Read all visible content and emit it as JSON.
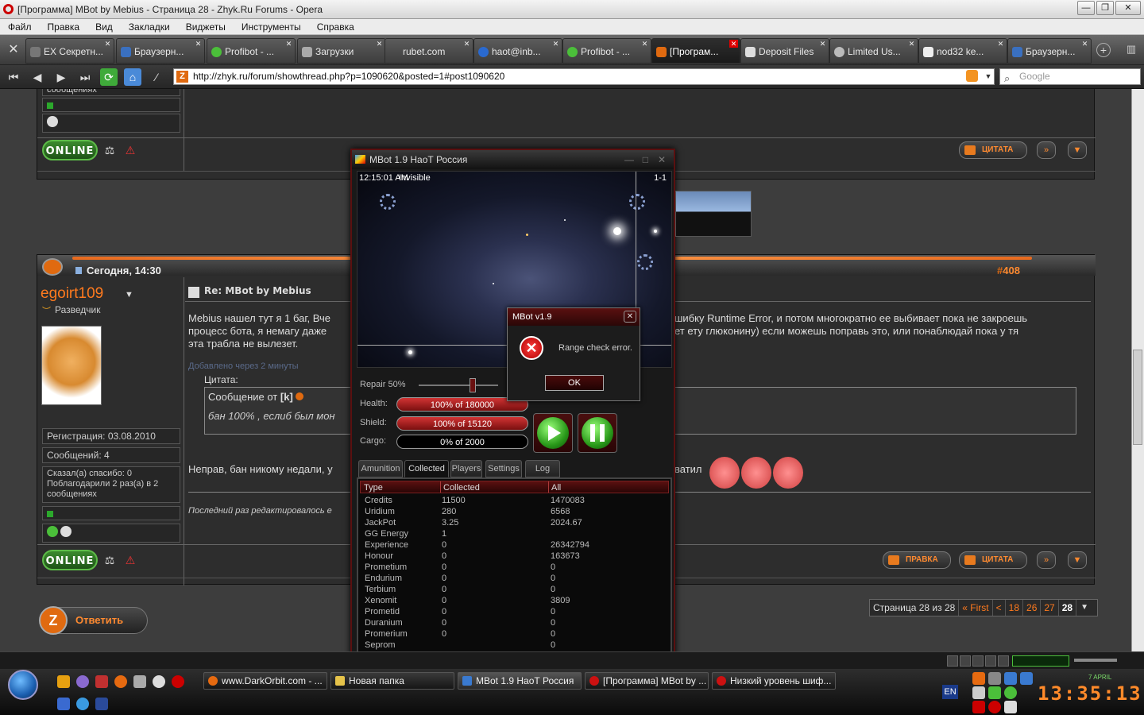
{
  "window": {
    "title": "[Программа] MBot by Mebius - Страница 28 - Zhyk.Ru Forums - Opera",
    "buttons": {
      "min": "—",
      "max": "❐",
      "close": "✕"
    }
  },
  "menu": [
    "Файл",
    "Правка",
    "Вид",
    "Закладки",
    "Виджеты",
    "Инструменты",
    "Справка"
  ],
  "tabs": [
    {
      "label": "EX Секретн..."
    },
    {
      "label": "Браузерн..."
    },
    {
      "label": "Profibot - ..."
    },
    {
      "label": "Загрузки"
    },
    {
      "label": "rubet.com"
    },
    {
      "label": "haot@inb..."
    },
    {
      "label": "Profibot - ..."
    },
    {
      "label": "[Програм..."
    },
    {
      "label": "Deposit Files"
    },
    {
      "label": "Limited Us..."
    },
    {
      "label": "nod32 ke..."
    },
    {
      "label": "Браузерн..."
    }
  ],
  "address": {
    "url": "http://zhyk.ru/forum/showthread.php?p=1090620&posted=1#post1090620",
    "search_placeholder": "Google"
  },
  "forum": {
    "prev_post": {
      "cell_text": "сообщениях",
      "online": "ONLINE",
      "quote": "ЦИТАТА"
    },
    "post": {
      "date": "Сегодня, 14:30",
      "number_prefix": "#",
      "number": "408",
      "username": "egoirt109",
      "rank": "Разведчик",
      "title": "Re: MBot by Mebius",
      "body_line1": "Mebius нашел тут я 1 баг, Вче",
      "body_line1_right": "шибку Runtime Error, и потом многократно ее выбивает пока не закроешь",
      "body_line2": "процесс бота, я немагу даже",
      "body_line2_right": "ет ету глюконину) если можешь поправь это, или понаблюдай пока у тя",
      "body_line3": "эта трабла не вылезет.",
      "added": "Добавлено через 2 минуты",
      "quote_label": "Цитата:",
      "quote_from": "Сообщение от",
      "quote_author": "[k]",
      "quote_text": "бан 100% , еслиб был мон",
      "reply_text": "Неправ, бан никому недали, у",
      "reply_text_right": "ватил",
      "edited": "Последний раз редактировалось е",
      "reg": "Регистрация: 03.08.2010",
      "msgs": "Сообщений: 4",
      "thanks": "Сказал(а) спасибо: 0 Поблагодарили 2 раз(а) в 2 сообщениях",
      "online": "ONLINE",
      "edit_btn": "ПРАВКА",
      "quote_btn": "ЦИТАТА"
    },
    "reply_button": "Ответить",
    "pagination": {
      "info": "Страница 28 из 28",
      "first": "« First",
      "prev": "<",
      "pages": [
        "18",
        "26",
        "27"
      ],
      "current": "28"
    }
  },
  "mbot": {
    "title": "MBot 1.9 НаоТ Россия",
    "map_time": "12:15:01 AM",
    "map_status": "Invisible",
    "map_id": "1-1",
    "repair_label": "Repair 50%",
    "repair_level": 0.5,
    "health_label": "Health:",
    "health_value": "100% of 180000",
    "shield_label": "Shield:",
    "shield_value": "100% of 15120",
    "cargo_label": "Cargo:",
    "cargo_value": "0% of 2000",
    "tabs": [
      "Amunition",
      "Collected",
      "Players",
      "Settings",
      "Log"
    ],
    "active_tab": "Collected",
    "table": {
      "headers": [
        "Type",
        "Collected",
        "All"
      ],
      "rows": [
        [
          "Credits",
          "11500",
          "1470083"
        ],
        [
          "Uridium",
          "280",
          "6568"
        ],
        [
          "JackPot",
          "3.25",
          "2024.67"
        ],
        [
          "GG Energy",
          "1",
          ""
        ],
        [
          "Experience",
          "0",
          "26342794"
        ],
        [
          "Honour",
          "0",
          "163673"
        ],
        [
          "Prometium",
          "0",
          "0"
        ],
        [
          "Endurium",
          "0",
          "0"
        ],
        [
          "Terbium",
          "0",
          "0"
        ],
        [
          "Xenomit",
          "0",
          "3809"
        ],
        [
          "Prometid",
          "0",
          "0"
        ],
        [
          "Duranium",
          "0",
          "0"
        ],
        [
          "Promerium",
          "0",
          "0"
        ],
        [
          "Seprom",
          "",
          "0"
        ]
      ]
    }
  },
  "error_dialog": {
    "title": "MBot v1.9",
    "message": "Range check error.",
    "ok": "OK",
    "close": "✕"
  },
  "taskbar": {
    "buttons": [
      {
        "label": "www.DarkOrbit.com - ...",
        "color": "#e66a10"
      },
      {
        "label": "Новая папка",
        "color": "#e6c34a"
      },
      {
        "label": "MBot 1.9 НаоТ Россия",
        "color": "#3a7ad0"
      },
      {
        "label": "[Программа] MBot by ...",
        "color": "#cc1111"
      },
      {
        "label": "Низкий уровень шиф...",
        "color": "#cc1111"
      }
    ],
    "lang": "EN",
    "clock": "13:35:13",
    "date": "7 APRIL"
  }
}
